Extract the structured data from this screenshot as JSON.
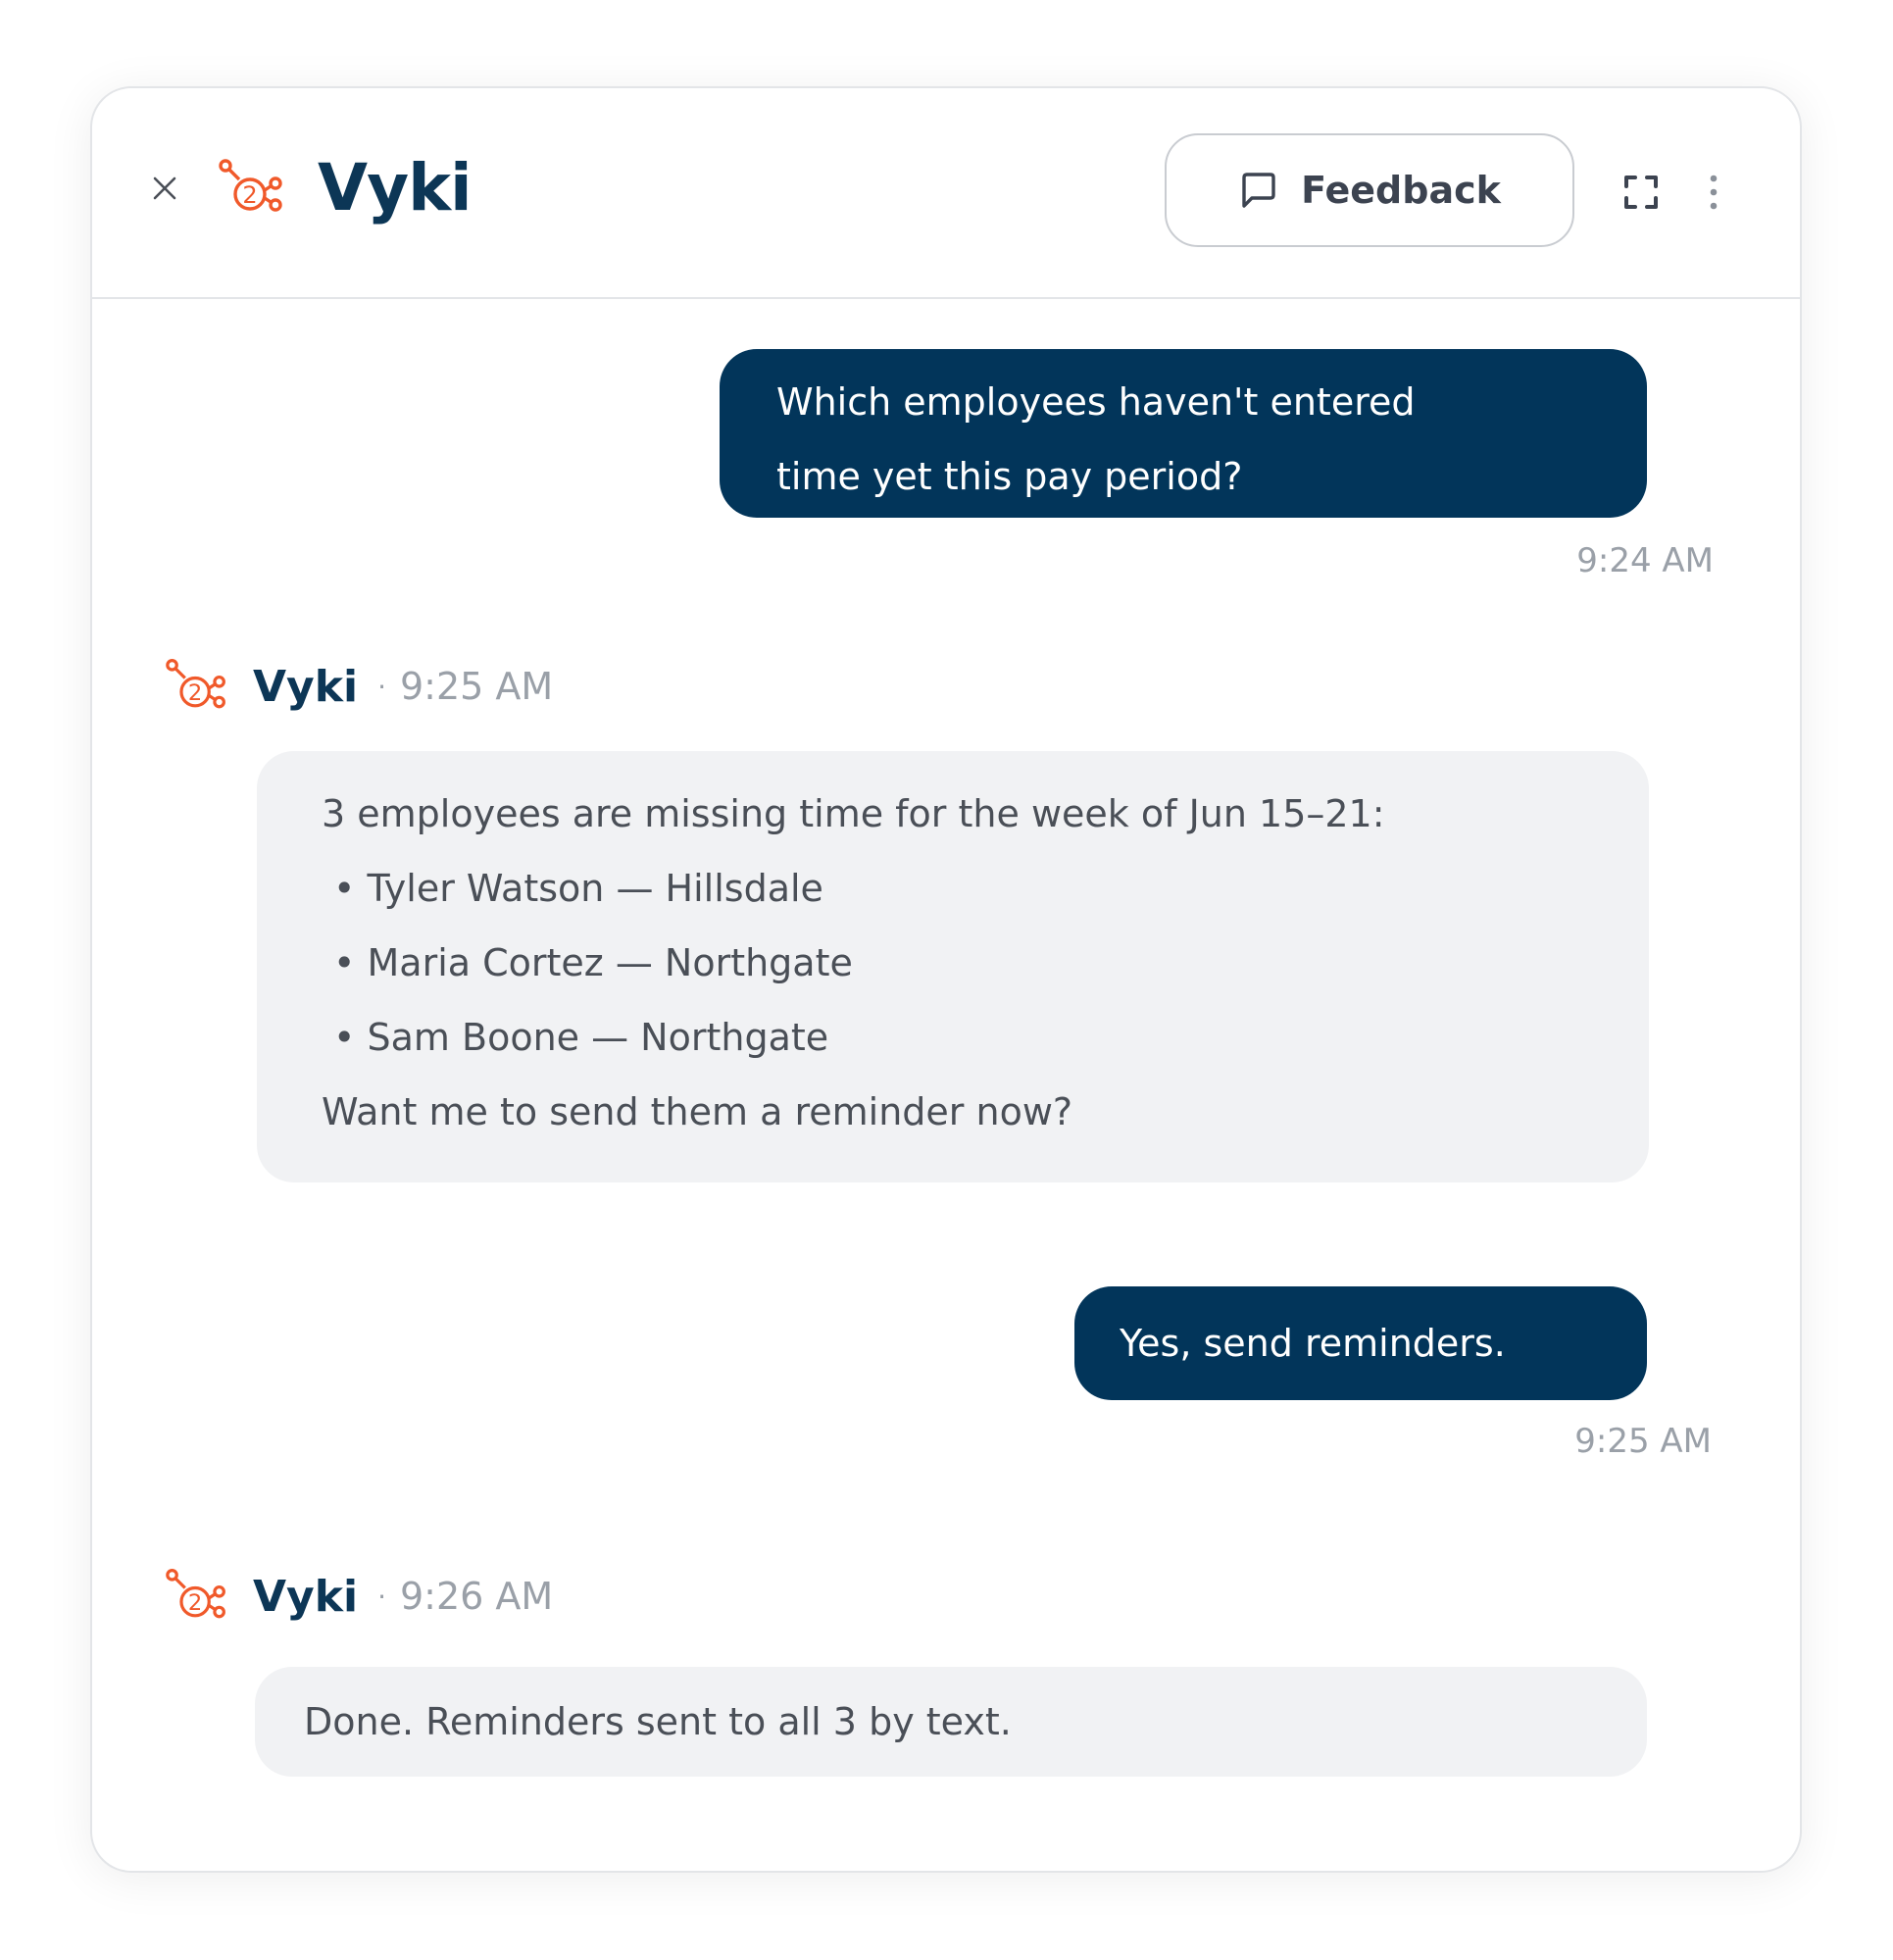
{
  "header": {
    "title": "Vyki",
    "feedback_label": "Feedback"
  },
  "conversation": {
    "user_msg_1": {
      "lines": [
        "Which employees haven't entered",
        "time yet this pay period?"
      ],
      "time": "9:24 AM"
    },
    "bot_msg_1": {
      "name": "Vyki",
      "separator": "·",
      "time": "9:25 AM",
      "intro": "3 employees are missing time for the week of Jun 15–21:",
      "items": [
        "• Tyler Watson — Hillsdale",
        "• Maria Cortez — Northgate",
        "• Sam Boone — Northgate"
      ],
      "outro": "Want me to send them a reminder now?"
    },
    "user_msg_2": {
      "text": "Yes, send reminders.",
      "time": "9:25 AM"
    },
    "bot_msg_2": {
      "name": "Vyki",
      "separator": "·",
      "time": "9:26 AM",
      "text": "Done. Reminders sent to all 3 by text."
    }
  },
  "colors": {
    "brand_navy": "#02355a",
    "brand_orange": "#f0592a",
    "bot_bubble_bg": "#f1f2f4"
  },
  "icons": {
    "close": "close-icon",
    "logo": "vyki-logo-icon",
    "feedback": "chat-bubble-icon",
    "expand": "expand-icon",
    "more": "more-vertical-icon"
  }
}
